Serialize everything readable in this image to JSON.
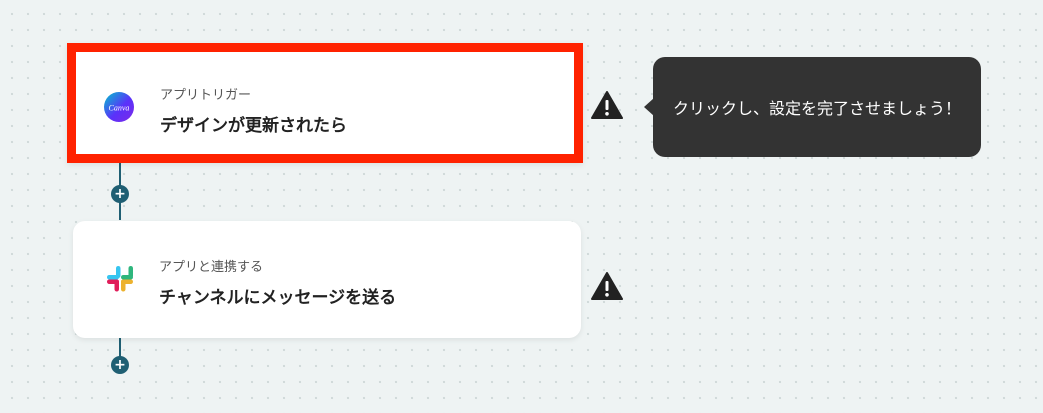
{
  "flow": {
    "steps": [
      {
        "type_label": "アプリトリガー",
        "title": "デザインが更新されたら",
        "app_icon": "canva-icon",
        "app_icon_text": "Canva",
        "status_icon": "warning-icon",
        "selected": true
      },
      {
        "type_label": "アプリと連携する",
        "title": "チャンネルにメッセージを送る",
        "app_icon": "slack-icon",
        "status_icon": "warning-icon",
        "selected": false
      }
    ],
    "add_step_icon": "plus-icon",
    "add_step_symbol": "+"
  },
  "tooltip": {
    "text": "クリックし、設定を完了させましょう！"
  },
  "colors": {
    "highlight_border": "#ff2200",
    "connector": "#1f5f73",
    "tooltip_bg": "#333333",
    "canvas_bg": "#eef3f3"
  }
}
